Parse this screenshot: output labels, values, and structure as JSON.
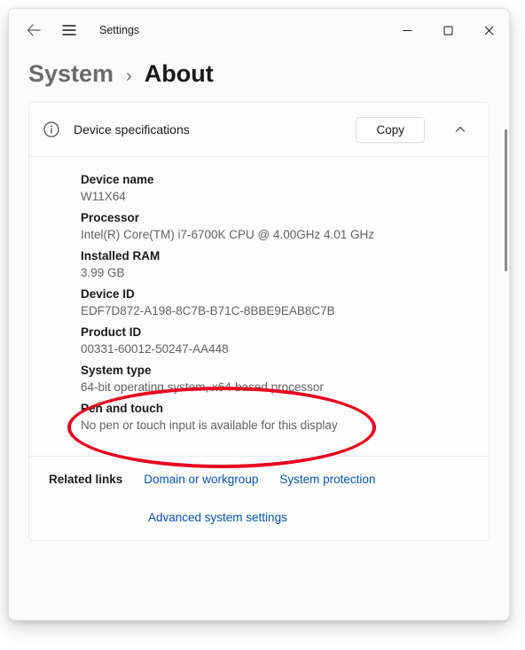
{
  "app": {
    "title": "Settings"
  },
  "breadcrumb": {
    "parent": "System",
    "separator": "›",
    "current": "About"
  },
  "card": {
    "title": "Device specifications",
    "copy_label": "Copy",
    "specs": [
      {
        "label": "Device name",
        "value": "W11X64"
      },
      {
        "label": "Processor",
        "value": "Intel(R) Core(TM) i7-6700K CPU @ 4.00GHz   4.01 GHz"
      },
      {
        "label": "Installed RAM",
        "value": "3.99 GB"
      },
      {
        "label": "Device ID",
        "value": "EDF7D872-A198-8C7B-B71C-8BBE9EAB8C7B"
      },
      {
        "label": "Product ID",
        "value": "00331-60012-50247-AA448"
      },
      {
        "label": "System type",
        "value": "64-bit operating system, x64-based processor"
      },
      {
        "label": "Pen and touch",
        "value": "No pen or touch input is available for this display"
      }
    ]
  },
  "related": {
    "label": "Related links",
    "links": [
      "Domain or workgroup",
      "System protection",
      "Advanced system settings"
    ]
  }
}
